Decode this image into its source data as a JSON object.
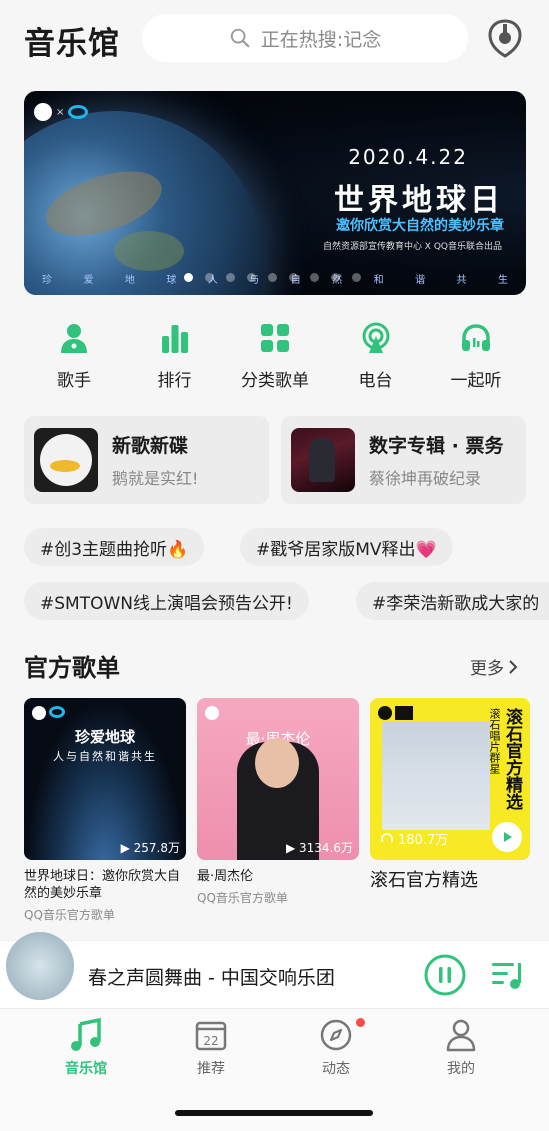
{
  "header": {
    "title": "音乐馆",
    "search_placeholder": "正在热搜:记念"
  },
  "banner": {
    "date": "2020.4.22",
    "title": "世界地球日",
    "subtitle": "邀你欣赏大自然的美妙乐章",
    "org": "自然资源部宣传教育中心 X QQ音乐联合出品",
    "tagline": [
      "珍",
      "爱",
      "地",
      "球",
      "人",
      "与",
      "自",
      "然",
      "和",
      "谐",
      "共",
      "生"
    ]
  },
  "categories": [
    {
      "label": "歌手",
      "icon": "singer-icon"
    },
    {
      "label": "排行",
      "icon": "chart-icon"
    },
    {
      "label": "分类歌单",
      "icon": "grid-icon"
    },
    {
      "label": "电台",
      "icon": "radio-icon"
    },
    {
      "label": "一起听",
      "icon": "headphones-icon"
    }
  ],
  "feature_cards": [
    {
      "title": "新歌新碟",
      "subtitle": "鹅就是实红!"
    },
    {
      "title": "数字专辑 · 票务",
      "subtitle": "蔡徐坤再破纪录"
    }
  ],
  "tags": [
    "#创3主题曲抢听🔥",
    "#戳爷居家版MV释出💗",
    "#SMTOWN线上演唱会预告公开!",
    "#李荣浩新歌成大家的"
  ],
  "section": {
    "title": "官方歌单",
    "more": "更多"
  },
  "playlists": [
    {
      "cover_title": "珍爱地球",
      "cover_sub": "人与自然和谐共生",
      "count": "257.8万",
      "name": "世界地球日：邀你欣赏大自然的美妙乐章",
      "source": "QQ音乐官方歌单"
    },
    {
      "cover_title": "最·周杰伦",
      "count": "3134.6万",
      "name": "最·周杰伦",
      "source": "QQ音乐官方歌单"
    },
    {
      "cover_title": "滚石官方精选",
      "cover_sub": "滚石唱片群星",
      "count": "180.7万",
      "name": "滚石官方精选"
    }
  ],
  "player": {
    "track": "春之声圆舞曲 - 中国交响乐团"
  },
  "tabs": [
    {
      "label": "音乐馆",
      "icon": "music-note-icon",
      "active": true
    },
    {
      "label": "推荐",
      "icon": "calendar-icon",
      "date": "22"
    },
    {
      "label": "动态",
      "icon": "compass-icon"
    },
    {
      "label": "我的",
      "icon": "person-icon"
    }
  ],
  "colors": {
    "accent": "#31c27c",
    "banner_subtitle": "#4dc0ff",
    "notification": "#ff4a4a"
  }
}
